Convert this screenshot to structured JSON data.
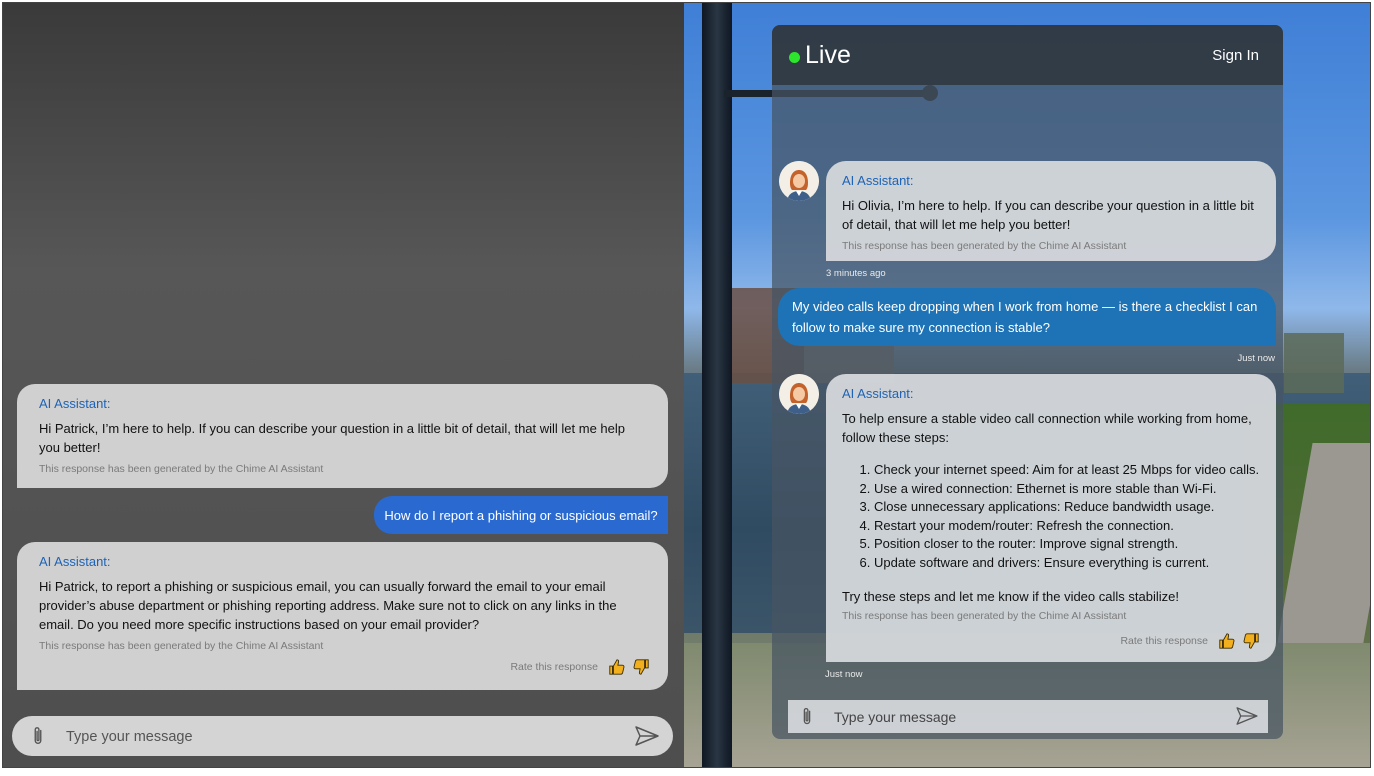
{
  "left_panel": {
    "messages": {
      "ai1": {
        "label": "AI Assistant:",
        "text": "Hi Patrick, I’m here to help. If you can describe your question in a little bit of detail, that will let me help you better!",
        "disclaimer": "This response has been generated by the Chime AI Assistant"
      },
      "user1": {
        "text": "How do I report a phishing or suspicious email?"
      },
      "ai2": {
        "label": "AI Assistant:",
        "text": "Hi Patrick, to report a phishing or suspicious email, you can usually forward the email to your email provider’s abuse department or phishing reporting address. Make sure not to click on any links in the email. Do you need more specific instructions based on your email provider?",
        "disclaimer": "This response has been generated by the Chime AI Assistant",
        "rate_label": "Rate this response"
      }
    },
    "input": {
      "placeholder": "Type your message"
    }
  },
  "right_panel": {
    "header": {
      "title": "Live",
      "sign_in": "Sign In"
    },
    "messages": {
      "ai1": {
        "label": "AI Assistant:",
        "text": "Hi Olivia, I’m here to help. If you can describe your question in a little bit of detail, that will let me help you better!",
        "disclaimer": "This response has been generated by the Chime AI Assistant",
        "timestamp": "3 minutes ago"
      },
      "user1": {
        "text": "My video calls keep dropping when I work from home — is there a checklist I can follow to make sure my connection is stable?",
        "timestamp": "Just now"
      },
      "ai2": {
        "label": "AI Assistant:",
        "intro": "To help ensure a stable video call connection while working from home, follow these steps:",
        "steps": [
          "Check your internet speed: Aim for at least 25 Mbps for video calls.",
          "Use a wired connection: Ethernet is more stable than Wi-Fi.",
          "Close unnecessary applications: Reduce bandwidth usage.",
          "Restart your modem/router: Refresh the connection.",
          "Position closer to the router: Improve signal strength.",
          "Update software and drivers: Ensure everything is current."
        ],
        "outro": "Try these steps and let me know if the video calls stabilize!",
        "disclaimer": "This response has been generated by the Chime AI Assistant",
        "rate_label": "Rate this response",
        "timestamp": "Just now"
      }
    },
    "input": {
      "placeholder": "Type your message"
    }
  },
  "colors": {
    "ai_label": "#1e63b5",
    "left_user_bubble": "#2a6ad0",
    "right_user_bubble": "#1d73b6",
    "live_dot": "#2ee52e",
    "thumb_icon": "#f2b01e"
  },
  "icons": [
    "paperclip-icon",
    "send-icon",
    "thumbs-up-icon",
    "thumbs-down-icon",
    "avatar-icon"
  ]
}
